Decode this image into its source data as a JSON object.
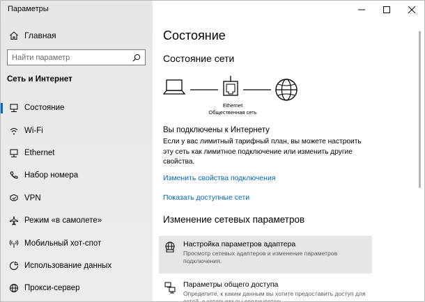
{
  "window": {
    "title": "Параметры"
  },
  "sidebar": {
    "home_label": "Главная",
    "search_placeholder": "Найти параметр",
    "section_title": "Сеть и Интернет",
    "items": [
      {
        "label": "Состояние",
        "icon": "network-status-icon",
        "active": true
      },
      {
        "label": "Wi-Fi",
        "icon": "wifi-icon"
      },
      {
        "label": "Ethernet",
        "icon": "ethernet-icon"
      },
      {
        "label": "Набор номера",
        "icon": "phone-icon"
      },
      {
        "label": "VPN",
        "icon": "vpn-icon"
      },
      {
        "label": "Режим «в самолете»",
        "icon": "airplane-icon"
      },
      {
        "label": "Мобильный хот-спот",
        "icon": "hotspot-icon"
      },
      {
        "label": "Использование данных",
        "icon": "data-usage-icon"
      },
      {
        "label": "Прокси-сервер",
        "icon": "globe-icon"
      }
    ]
  },
  "main": {
    "title": "Состояние",
    "network_heading": "Состояние сети",
    "diagram": {
      "adapter_name": "Ethernet",
      "network_type": "Общественная сеть"
    },
    "connected_text": "Вы подключены к Интернету",
    "description": "Если у вас лимитный тарифный план, вы можете настроить эту сеть как лимитное подключение или изменить другие свойства.",
    "link_change_props": "Изменить свойства подключения",
    "link_show_networks": "Показать доступные сети",
    "change_heading": "Изменение сетевых параметров",
    "options": [
      {
        "title": "Настройка параметров адаптера",
        "subtitle": "Просмотр сетевых адаптеров и изменение параметров подключения."
      },
      {
        "title": "Параметры общего доступа",
        "subtitle": "Определите, к каким данным вы хотите предоставить доступ для сетей, с которыми вы соединяетесь."
      }
    ]
  },
  "colors": {
    "accent": "#0067c0",
    "sidebar_bg": "#e9e9e9",
    "hover_bg": "#e6e6e6"
  }
}
